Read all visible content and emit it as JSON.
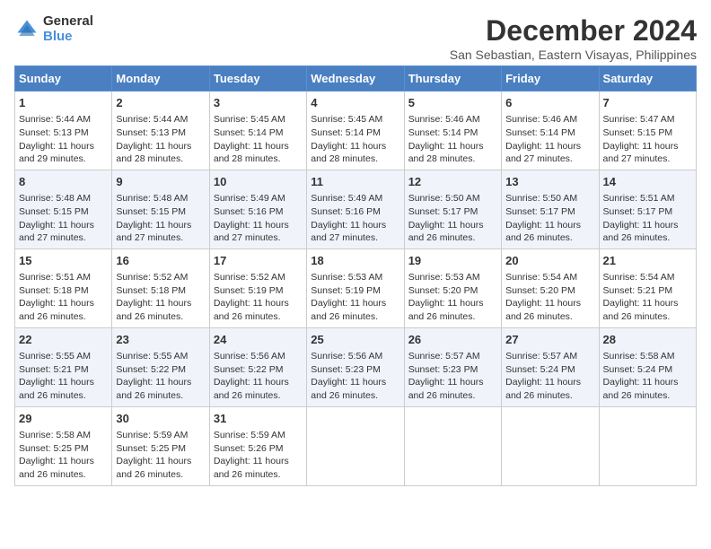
{
  "logo": {
    "general": "General",
    "blue": "Blue"
  },
  "title": "December 2024",
  "subtitle": "San Sebastian, Eastern Visayas, Philippines",
  "days_of_week": [
    "Sunday",
    "Monday",
    "Tuesday",
    "Wednesday",
    "Thursday",
    "Friday",
    "Saturday"
  ],
  "weeks": [
    [
      {
        "day": "1",
        "info": "Sunrise: 5:44 AM\nSunset: 5:13 PM\nDaylight: 11 hours\nand 29 minutes."
      },
      {
        "day": "2",
        "info": "Sunrise: 5:44 AM\nSunset: 5:13 PM\nDaylight: 11 hours\nand 28 minutes."
      },
      {
        "day": "3",
        "info": "Sunrise: 5:45 AM\nSunset: 5:14 PM\nDaylight: 11 hours\nand 28 minutes."
      },
      {
        "day": "4",
        "info": "Sunrise: 5:45 AM\nSunset: 5:14 PM\nDaylight: 11 hours\nand 28 minutes."
      },
      {
        "day": "5",
        "info": "Sunrise: 5:46 AM\nSunset: 5:14 PM\nDaylight: 11 hours\nand 28 minutes."
      },
      {
        "day": "6",
        "info": "Sunrise: 5:46 AM\nSunset: 5:14 PM\nDaylight: 11 hours\nand 27 minutes."
      },
      {
        "day": "7",
        "info": "Sunrise: 5:47 AM\nSunset: 5:15 PM\nDaylight: 11 hours\nand 27 minutes."
      }
    ],
    [
      {
        "day": "8",
        "info": "Sunrise: 5:48 AM\nSunset: 5:15 PM\nDaylight: 11 hours\nand 27 minutes."
      },
      {
        "day": "9",
        "info": "Sunrise: 5:48 AM\nSunset: 5:15 PM\nDaylight: 11 hours\nand 27 minutes."
      },
      {
        "day": "10",
        "info": "Sunrise: 5:49 AM\nSunset: 5:16 PM\nDaylight: 11 hours\nand 27 minutes."
      },
      {
        "day": "11",
        "info": "Sunrise: 5:49 AM\nSunset: 5:16 PM\nDaylight: 11 hours\nand 27 minutes."
      },
      {
        "day": "12",
        "info": "Sunrise: 5:50 AM\nSunset: 5:17 PM\nDaylight: 11 hours\nand 26 minutes."
      },
      {
        "day": "13",
        "info": "Sunrise: 5:50 AM\nSunset: 5:17 PM\nDaylight: 11 hours\nand 26 minutes."
      },
      {
        "day": "14",
        "info": "Sunrise: 5:51 AM\nSunset: 5:17 PM\nDaylight: 11 hours\nand 26 minutes."
      }
    ],
    [
      {
        "day": "15",
        "info": "Sunrise: 5:51 AM\nSunset: 5:18 PM\nDaylight: 11 hours\nand 26 minutes."
      },
      {
        "day": "16",
        "info": "Sunrise: 5:52 AM\nSunset: 5:18 PM\nDaylight: 11 hours\nand 26 minutes."
      },
      {
        "day": "17",
        "info": "Sunrise: 5:52 AM\nSunset: 5:19 PM\nDaylight: 11 hours\nand 26 minutes."
      },
      {
        "day": "18",
        "info": "Sunrise: 5:53 AM\nSunset: 5:19 PM\nDaylight: 11 hours\nand 26 minutes."
      },
      {
        "day": "19",
        "info": "Sunrise: 5:53 AM\nSunset: 5:20 PM\nDaylight: 11 hours\nand 26 minutes."
      },
      {
        "day": "20",
        "info": "Sunrise: 5:54 AM\nSunset: 5:20 PM\nDaylight: 11 hours\nand 26 minutes."
      },
      {
        "day": "21",
        "info": "Sunrise: 5:54 AM\nSunset: 5:21 PM\nDaylight: 11 hours\nand 26 minutes."
      }
    ],
    [
      {
        "day": "22",
        "info": "Sunrise: 5:55 AM\nSunset: 5:21 PM\nDaylight: 11 hours\nand 26 minutes."
      },
      {
        "day": "23",
        "info": "Sunrise: 5:55 AM\nSunset: 5:22 PM\nDaylight: 11 hours\nand 26 minutes."
      },
      {
        "day": "24",
        "info": "Sunrise: 5:56 AM\nSunset: 5:22 PM\nDaylight: 11 hours\nand 26 minutes."
      },
      {
        "day": "25",
        "info": "Sunrise: 5:56 AM\nSunset: 5:23 PM\nDaylight: 11 hours\nand 26 minutes."
      },
      {
        "day": "26",
        "info": "Sunrise: 5:57 AM\nSunset: 5:23 PM\nDaylight: 11 hours\nand 26 minutes."
      },
      {
        "day": "27",
        "info": "Sunrise: 5:57 AM\nSunset: 5:24 PM\nDaylight: 11 hours\nand 26 minutes."
      },
      {
        "day": "28",
        "info": "Sunrise: 5:58 AM\nSunset: 5:24 PM\nDaylight: 11 hours\nand 26 minutes."
      }
    ],
    [
      {
        "day": "29",
        "info": "Sunrise: 5:58 AM\nSunset: 5:25 PM\nDaylight: 11 hours\nand 26 minutes."
      },
      {
        "day": "30",
        "info": "Sunrise: 5:59 AM\nSunset: 5:25 PM\nDaylight: 11 hours\nand 26 minutes."
      },
      {
        "day": "31",
        "info": "Sunrise: 5:59 AM\nSunset: 5:26 PM\nDaylight: 11 hours\nand 26 minutes."
      },
      {
        "day": "",
        "info": ""
      },
      {
        "day": "",
        "info": ""
      },
      {
        "day": "",
        "info": ""
      },
      {
        "day": "",
        "info": ""
      }
    ]
  ]
}
